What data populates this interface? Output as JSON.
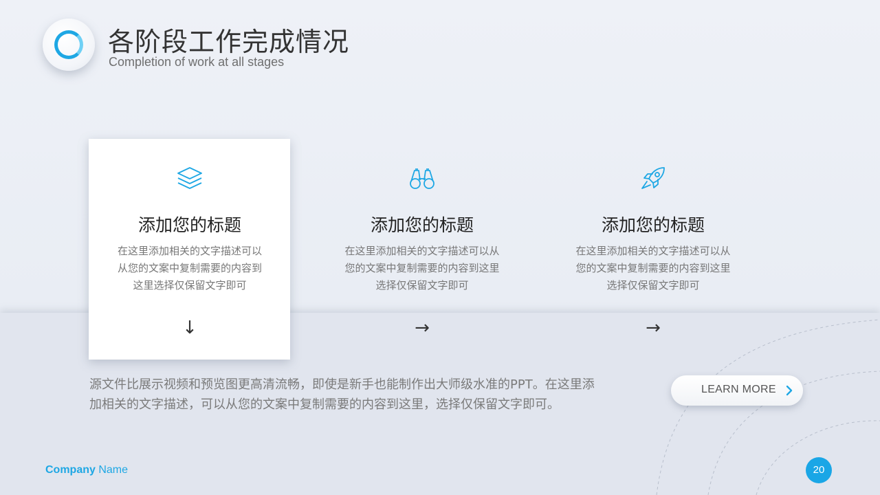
{
  "header": {
    "title": "各阶段工作完成情况",
    "subtitle": "Completion of work at all stages"
  },
  "cards": [
    {
      "icon": "layers-icon",
      "title": "添加您的标题",
      "desc_lines": [
        "在这里添加相关的文字描述可以",
        "从您的文案中复制需要的内容到",
        "这里选择仅保留文字即可"
      ],
      "arrow": "↓"
    },
    {
      "icon": "binoculars-icon",
      "title": "添加您的标题",
      "desc_lines": [
        "在这里添加相关的文字描述可以从",
        "您的文案中复制需要的内容到这里",
        "选择仅保留文字即可"
      ],
      "arrow": "→"
    },
    {
      "icon": "rocket-icon",
      "title": "添加您的标题",
      "desc_lines": [
        "在这里添加相关的文字描述可以从",
        "您的文案中复制需要的内容到这里",
        "选择仅保留文字即可"
      ],
      "arrow": "→"
    }
  ],
  "body": {
    "line1": "源文件比展示视频和预览图更高清流畅，即使是新手也能制作出大师级水准的PPT。在这里添",
    "line2": "加相关的文字描述，可以从您的文案中复制需要的内容到这里，选择仅保留文字即可。"
  },
  "cta": {
    "label": "LEARN MORE"
  },
  "footer": {
    "company_bold": "Company",
    "company_rest": " Name",
    "page_number": "20"
  },
  "colors": {
    "accent": "#1ea7e4",
    "page_badge": "#1aa6e6"
  }
}
